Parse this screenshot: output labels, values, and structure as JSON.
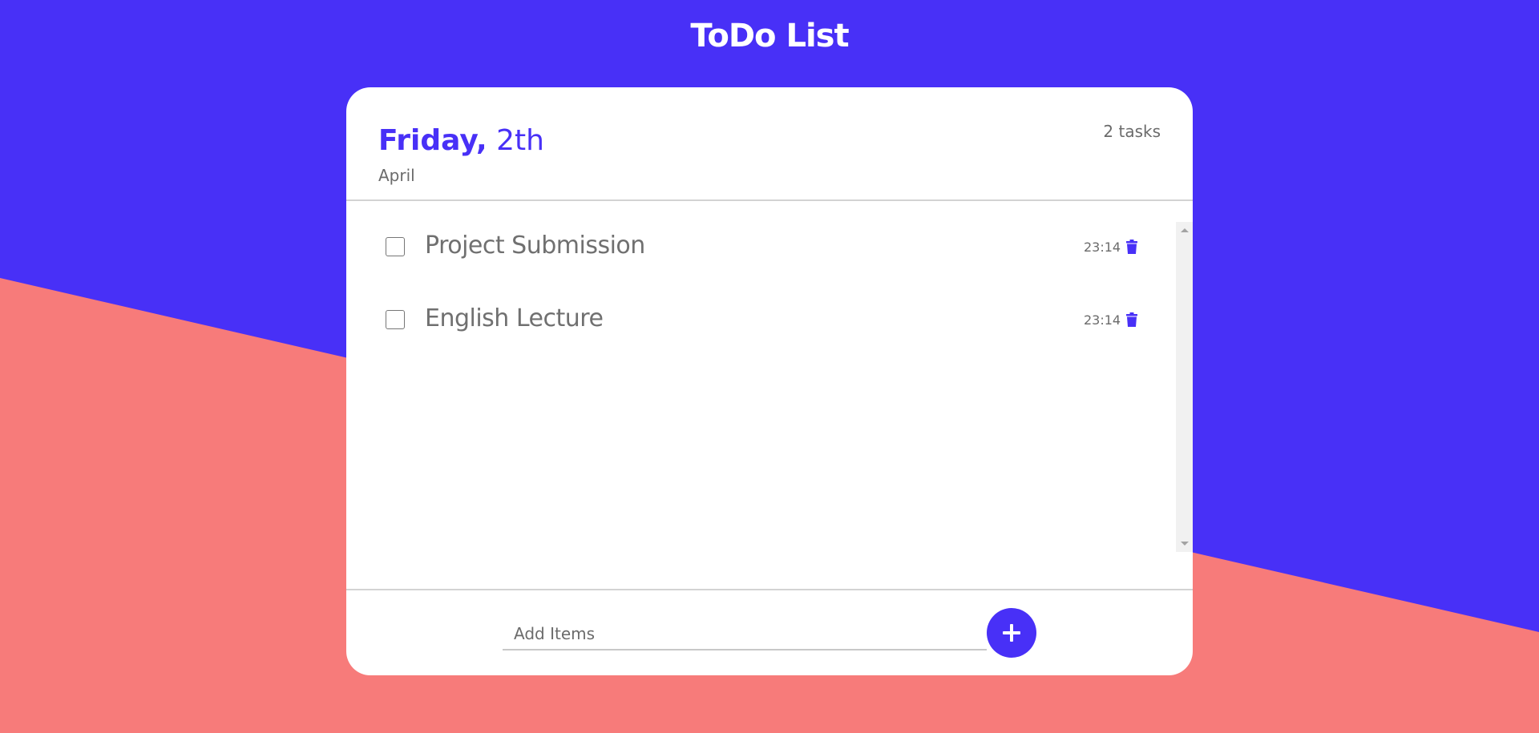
{
  "app": {
    "title": "ToDo List"
  },
  "header": {
    "day": "Friday,",
    "day_number": "2th",
    "month": "April",
    "task_count": "2 tasks"
  },
  "tasks": [
    {
      "text": "Project Submission",
      "time": "23:14",
      "checked": false
    },
    {
      "text": "English Lecture",
      "time": "23:14",
      "checked": false
    }
  ],
  "footer": {
    "input_placeholder": "Add Items",
    "input_value": "",
    "add_icon": "plus-icon"
  },
  "icons": {
    "delete": "trash-icon"
  },
  "colors": {
    "accent": "#4830f7",
    "background_bottom": "#f77b7a",
    "card": "#ffffff",
    "text_muted": "#6b6b6b"
  }
}
